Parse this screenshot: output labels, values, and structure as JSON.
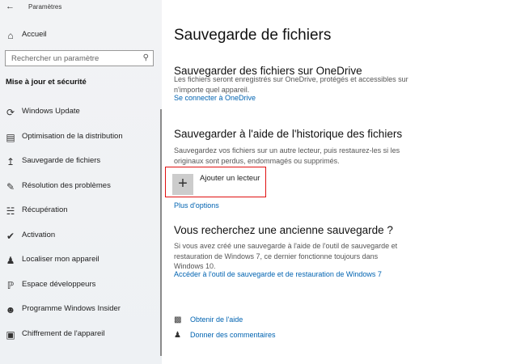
{
  "window": {
    "title": "Paramètres"
  },
  "sidebar": {
    "home": "Accueil",
    "search_placeholder": "Rechercher un paramètre",
    "section": "Mise à jour et sécurité",
    "items": [
      {
        "label": "Windows Update",
        "icon": "sync-icon"
      },
      {
        "label": "Optimisation de la distribution",
        "icon": "delivery-icon"
      },
      {
        "label": "Sauvegarde de fichiers",
        "icon": "backup-arrow-icon"
      },
      {
        "label": "Résolution des problèmes",
        "icon": "wrench-icon"
      },
      {
        "label": "Récupération",
        "icon": "recovery-icon"
      },
      {
        "label": "Activation",
        "icon": "check-circle-icon"
      },
      {
        "label": "Localiser mon appareil",
        "icon": "locate-person-icon"
      },
      {
        "label": "Espace développeurs",
        "icon": "developer-icon"
      },
      {
        "label": "Programme Windows Insider",
        "icon": "insider-cat-icon"
      },
      {
        "label": "Chiffrement de l'appareil",
        "icon": "lock-drive-icon"
      }
    ]
  },
  "main": {
    "title": "Sauvegarde de fichiers",
    "onedrive": {
      "heading": "Sauvegarder des fichiers sur OneDrive",
      "text": "Les fichiers seront enregistrés sur OneDrive, protégés et accessibles sur n'importe quel appareil.",
      "link": "Se connecter à OneDrive"
    },
    "history": {
      "heading": "Sauvegarder à l'aide de l'historique des fichiers",
      "text": "Sauvegardez vos fichiers sur un autre lecteur, puis restaurez-les si les originaux sont perdus, endommagés ou supprimés.",
      "add_drive": "Ajouter un lecteur",
      "more": "Plus d'options"
    },
    "old": {
      "heading": "Vous recherchez une ancienne sauvegarde ?",
      "text": "Si vous avez créé une sauvegarde à l'aide de l'outil de sauvegarde et restauration de Windows 7, ce dernier fonctionne toujours dans Windows 10.",
      "link": "Accéder à l'outil de sauvegarde et de restauration de Windows 7"
    },
    "help": "Obtenir de l'aide",
    "feedback": "Donner des commentaires"
  }
}
